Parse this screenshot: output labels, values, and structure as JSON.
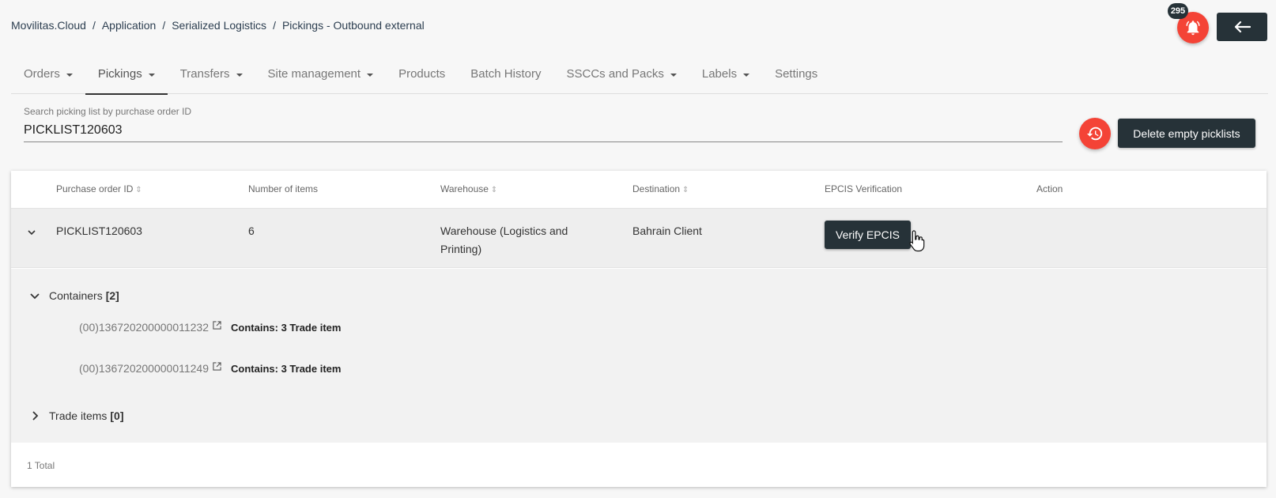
{
  "breadcrumb": [
    "Movilitas.Cloud",
    "Application",
    "Serialized Logistics",
    "Pickings - Outbound external"
  ],
  "notifications": {
    "count": "295",
    "icon": "bell-icon"
  },
  "back_icon": "arrow-left-icon",
  "tabs": [
    {
      "label": "Orders",
      "dropdown": true
    },
    {
      "label": "Pickings",
      "dropdown": true,
      "active": true
    },
    {
      "label": "Transfers",
      "dropdown": true
    },
    {
      "label": "Site management",
      "dropdown": true
    },
    {
      "label": "Products",
      "dropdown": false
    },
    {
      "label": "Batch History",
      "dropdown": false
    },
    {
      "label": "SSCCs and Packs",
      "dropdown": true
    },
    {
      "label": "Labels",
      "dropdown": true
    },
    {
      "label": "Settings",
      "dropdown": false
    }
  ],
  "search": {
    "label": "Search picking list by purchase order ID",
    "value": "PICKLIST120603"
  },
  "actions": {
    "history_icon": "history-icon",
    "delete_label": "Delete empty picklists"
  },
  "table": {
    "headers": {
      "po_id": "Purchase order ID",
      "items": "Number of items",
      "warehouse": "Warehouse",
      "destination": "Destination",
      "epcis": "EPCIS Verification",
      "action": "Action"
    },
    "row": {
      "po_id": "PICKLIST120603",
      "items": "6",
      "warehouse_line1": "Warehouse (Logistics and",
      "warehouse_line2": "Printing)",
      "destination": "Bahrain Client",
      "verify_label": "Verify EPCIS"
    },
    "details": {
      "containers_label": "Containers",
      "containers_count": "[2]",
      "containers": [
        {
          "id": "(00)136720200000011232",
          "contains": "Contains: 3 Trade item"
        },
        {
          "id": "(00)136720200000011249",
          "contains": "Contains: 3 Trade item"
        }
      ],
      "trade_items_label": "Trade items",
      "trade_items_count": "[0]"
    },
    "footer": "1 Total"
  },
  "colors": {
    "accent_red": "#f44336",
    "dark": "#263238"
  }
}
